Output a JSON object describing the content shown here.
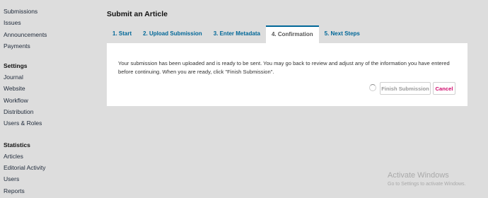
{
  "sidebar": {
    "group1": [
      "Submissions",
      "Issues",
      "Announcements",
      "Payments"
    ],
    "settings_heading": "Settings",
    "settings": [
      "Journal",
      "Website",
      "Workflow",
      "Distribution",
      "Users & Roles"
    ],
    "statistics_heading": "Statistics",
    "statistics": [
      "Articles",
      "Editorial Activity",
      "Users",
      "Reports"
    ]
  },
  "page": {
    "title": "Submit an Article"
  },
  "tabs": [
    "1. Start",
    "2. Upload Submission",
    "3. Enter Metadata",
    "4. Confirmation",
    "5. Next Steps"
  ],
  "active_tab": "4. Confirmation",
  "confirmation": {
    "message": "Your submission has been uploaded and is ready to be sent. You may go back to review and adjust any of the information you have entered before continuing. When you are ready, click \"Finish Submission\".",
    "finish_label": "Finish Submission",
    "cancel_label": "Cancel",
    "loading": true
  },
  "watermark": {
    "title": "Activate Windows",
    "subtitle": "Go to Settings to activate Windows."
  },
  "colors": {
    "link": "#006798",
    "cancel": "#d00a6c",
    "background": "#dddddd",
    "panel": "#ffffff"
  }
}
